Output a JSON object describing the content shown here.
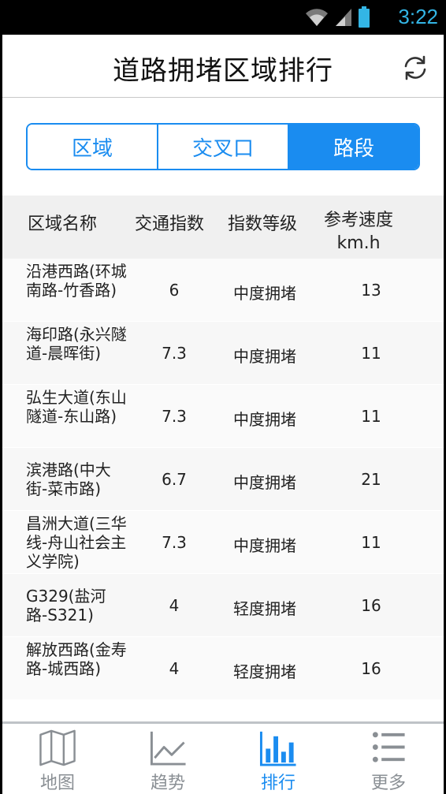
{
  "status_bar": {
    "time": "3:22"
  },
  "header": {
    "title": "道路拥堵区域排行"
  },
  "segments": [
    {
      "label": "区域",
      "active": false
    },
    {
      "label": "交叉口",
      "active": false
    },
    {
      "label": "路段",
      "active": true
    }
  ],
  "table": {
    "headers": [
      "区域名称",
      "交通指数",
      "指数等级",
      "参考速度",
      "km.h"
    ],
    "rows": [
      {
        "name": "沿港西路(环城南路-竹香路)",
        "index": "6",
        "level": "中度拥堵",
        "speed": "13"
      },
      {
        "name": "海印路(永兴隧道-晨晖街)",
        "index": "7.3",
        "level": "中度拥堵",
        "speed": "11"
      },
      {
        "name": "弘生大道(东山隧道-东山路)",
        "index": "7.3",
        "level": "中度拥堵",
        "speed": "11"
      },
      {
        "name": "滨港路(中大街-菜市路)",
        "index": "6.7",
        "level": "中度拥堵",
        "speed": "21"
      },
      {
        "name": "昌洲大道(三华线-舟山社会主义学院)",
        "index": "7.3",
        "level": "中度拥堵",
        "speed": "11"
      },
      {
        "name": "G329(盐河路-S321)",
        "index": "4",
        "level": "轻度拥堵",
        "speed": "16"
      },
      {
        "name": "解放西路(金寿路-城西路)",
        "index": "4",
        "level": "轻度拥堵",
        "speed": "16"
      }
    ]
  },
  "tabbar": {
    "items": [
      {
        "label": "地图",
        "icon": "map-icon",
        "active": false
      },
      {
        "label": "趋势",
        "icon": "trend-icon",
        "active": false
      },
      {
        "label": "排行",
        "icon": "bar-chart-icon",
        "active": true
      },
      {
        "label": "更多",
        "icon": "list-icon",
        "active": false
      }
    ]
  },
  "colors": {
    "accent": "#1a8cf0",
    "status_time": "#33b5e5"
  }
}
